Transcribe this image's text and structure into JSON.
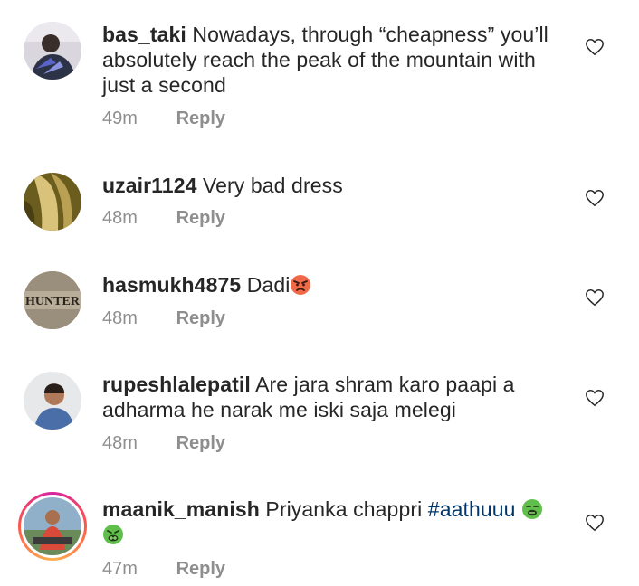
{
  "comments": [
    {
      "username": "bas_taki",
      "text": "Nowadays, through “cheapness” you’ll absolutely reach the peak of the mountain with just a second",
      "time": "49m",
      "reply_label": "Reply",
      "avatar_icon": "person-avatar-icon"
    },
    {
      "username": "uzair1124",
      "text": "Very bad dress",
      "time": "48m",
      "reply_label": "Reply",
      "avatar_icon": "blonde-hair-avatar-icon"
    },
    {
      "username": "hasmukh4875",
      "text": "Dadi",
      "emoji": "angry-face-icon",
      "time": "48m",
      "reply_label": "Reply",
      "avatar_icon": "hunter-logo-avatar-icon",
      "avatar_text": "HUNTER"
    },
    {
      "username": "rupeshlalepatil",
      "text": "Are jara shram karo paapi a adharma he narak me iski saja melegi",
      "time": "48m",
      "reply_label": "Reply",
      "avatar_icon": "person-avatar-icon"
    },
    {
      "username": "maanik_manish",
      "text": "Priyanka chappri ",
      "hashtag": "#aathuuu",
      "emoji": "vomiting-face-icon",
      "time": "47m",
      "reply_label": "Reply",
      "avatar_icon": "person-avatar-icon"
    }
  ],
  "colors": {
    "text": "#262626",
    "meta": "#8e8e8e",
    "hashtag": "#00376b"
  }
}
